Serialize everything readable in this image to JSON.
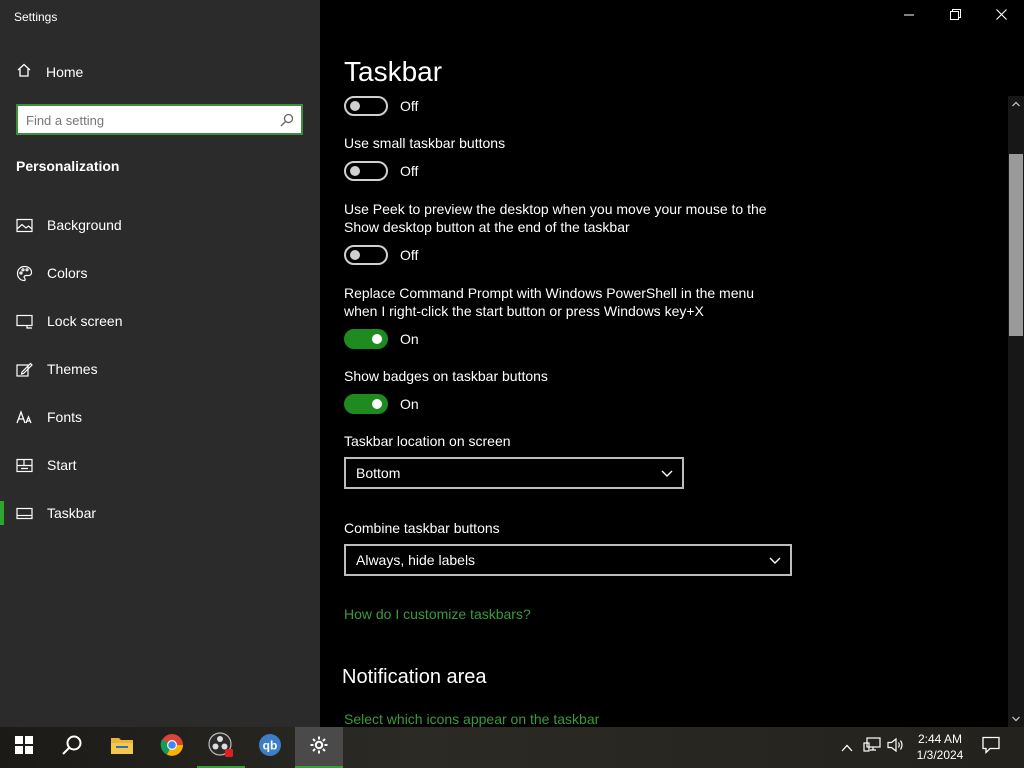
{
  "window": {
    "title": "Settings",
    "controls": {
      "minimize": "minimize",
      "restore": "restore",
      "close": "close"
    }
  },
  "sidebar": {
    "home_label": "Home",
    "search_placeholder": "Find a setting",
    "section_label": "Personalization",
    "items": [
      {
        "label": "Background",
        "icon": "image-icon"
      },
      {
        "label": "Colors",
        "icon": "palette-icon"
      },
      {
        "label": "Lock screen",
        "icon": "monitor-icon"
      },
      {
        "label": "Themes",
        "icon": "pencil-icon"
      },
      {
        "label": "Fonts",
        "icon": "font-icon"
      },
      {
        "label": "Start",
        "icon": "start-grid-icon"
      },
      {
        "label": "Taskbar",
        "icon": "taskbar-icon",
        "active": true
      }
    ]
  },
  "main": {
    "title": "Taskbar",
    "toggle_top_state": "Off",
    "small_buttons": {
      "label": "Use small taskbar buttons",
      "state": "Off",
      "on": false
    },
    "peek": {
      "label": "Use Peek to preview the desktop when you move your mouse to the Show desktop button at the end of the taskbar",
      "state": "Off",
      "on": false
    },
    "powershell": {
      "label": "Replace Command Prompt with Windows PowerShell in the menu when I right-click the start button or press Windows key+X",
      "state": "On",
      "on": true
    },
    "badges": {
      "label": "Show badges on taskbar buttons",
      "state": "On",
      "on": true
    },
    "location": {
      "label": "Taskbar location on screen",
      "value": "Bottom"
    },
    "combine": {
      "label": "Combine taskbar buttons",
      "value": "Always, hide labels"
    },
    "help_link": "How do I customize taskbars?",
    "notification_heading": "Notification area",
    "notification_link": "Select which icons appear on the taskbar"
  },
  "taskbar": {
    "apps": [
      "start-icon",
      "search-icon",
      "file-explorer-icon",
      "chrome-icon",
      "obs-icon",
      "qbittorrent-icon",
      "settings-gear-icon"
    ],
    "clock_time": "2:44 AM",
    "clock_date": "1/3/2024"
  },
  "colors": {
    "accent": "#2ea62e",
    "toggle_on": "#1f8a1f",
    "link": "#3b9a3b",
    "sidebar_bg": "#2b2b2b",
    "content_bg": "#000000"
  }
}
